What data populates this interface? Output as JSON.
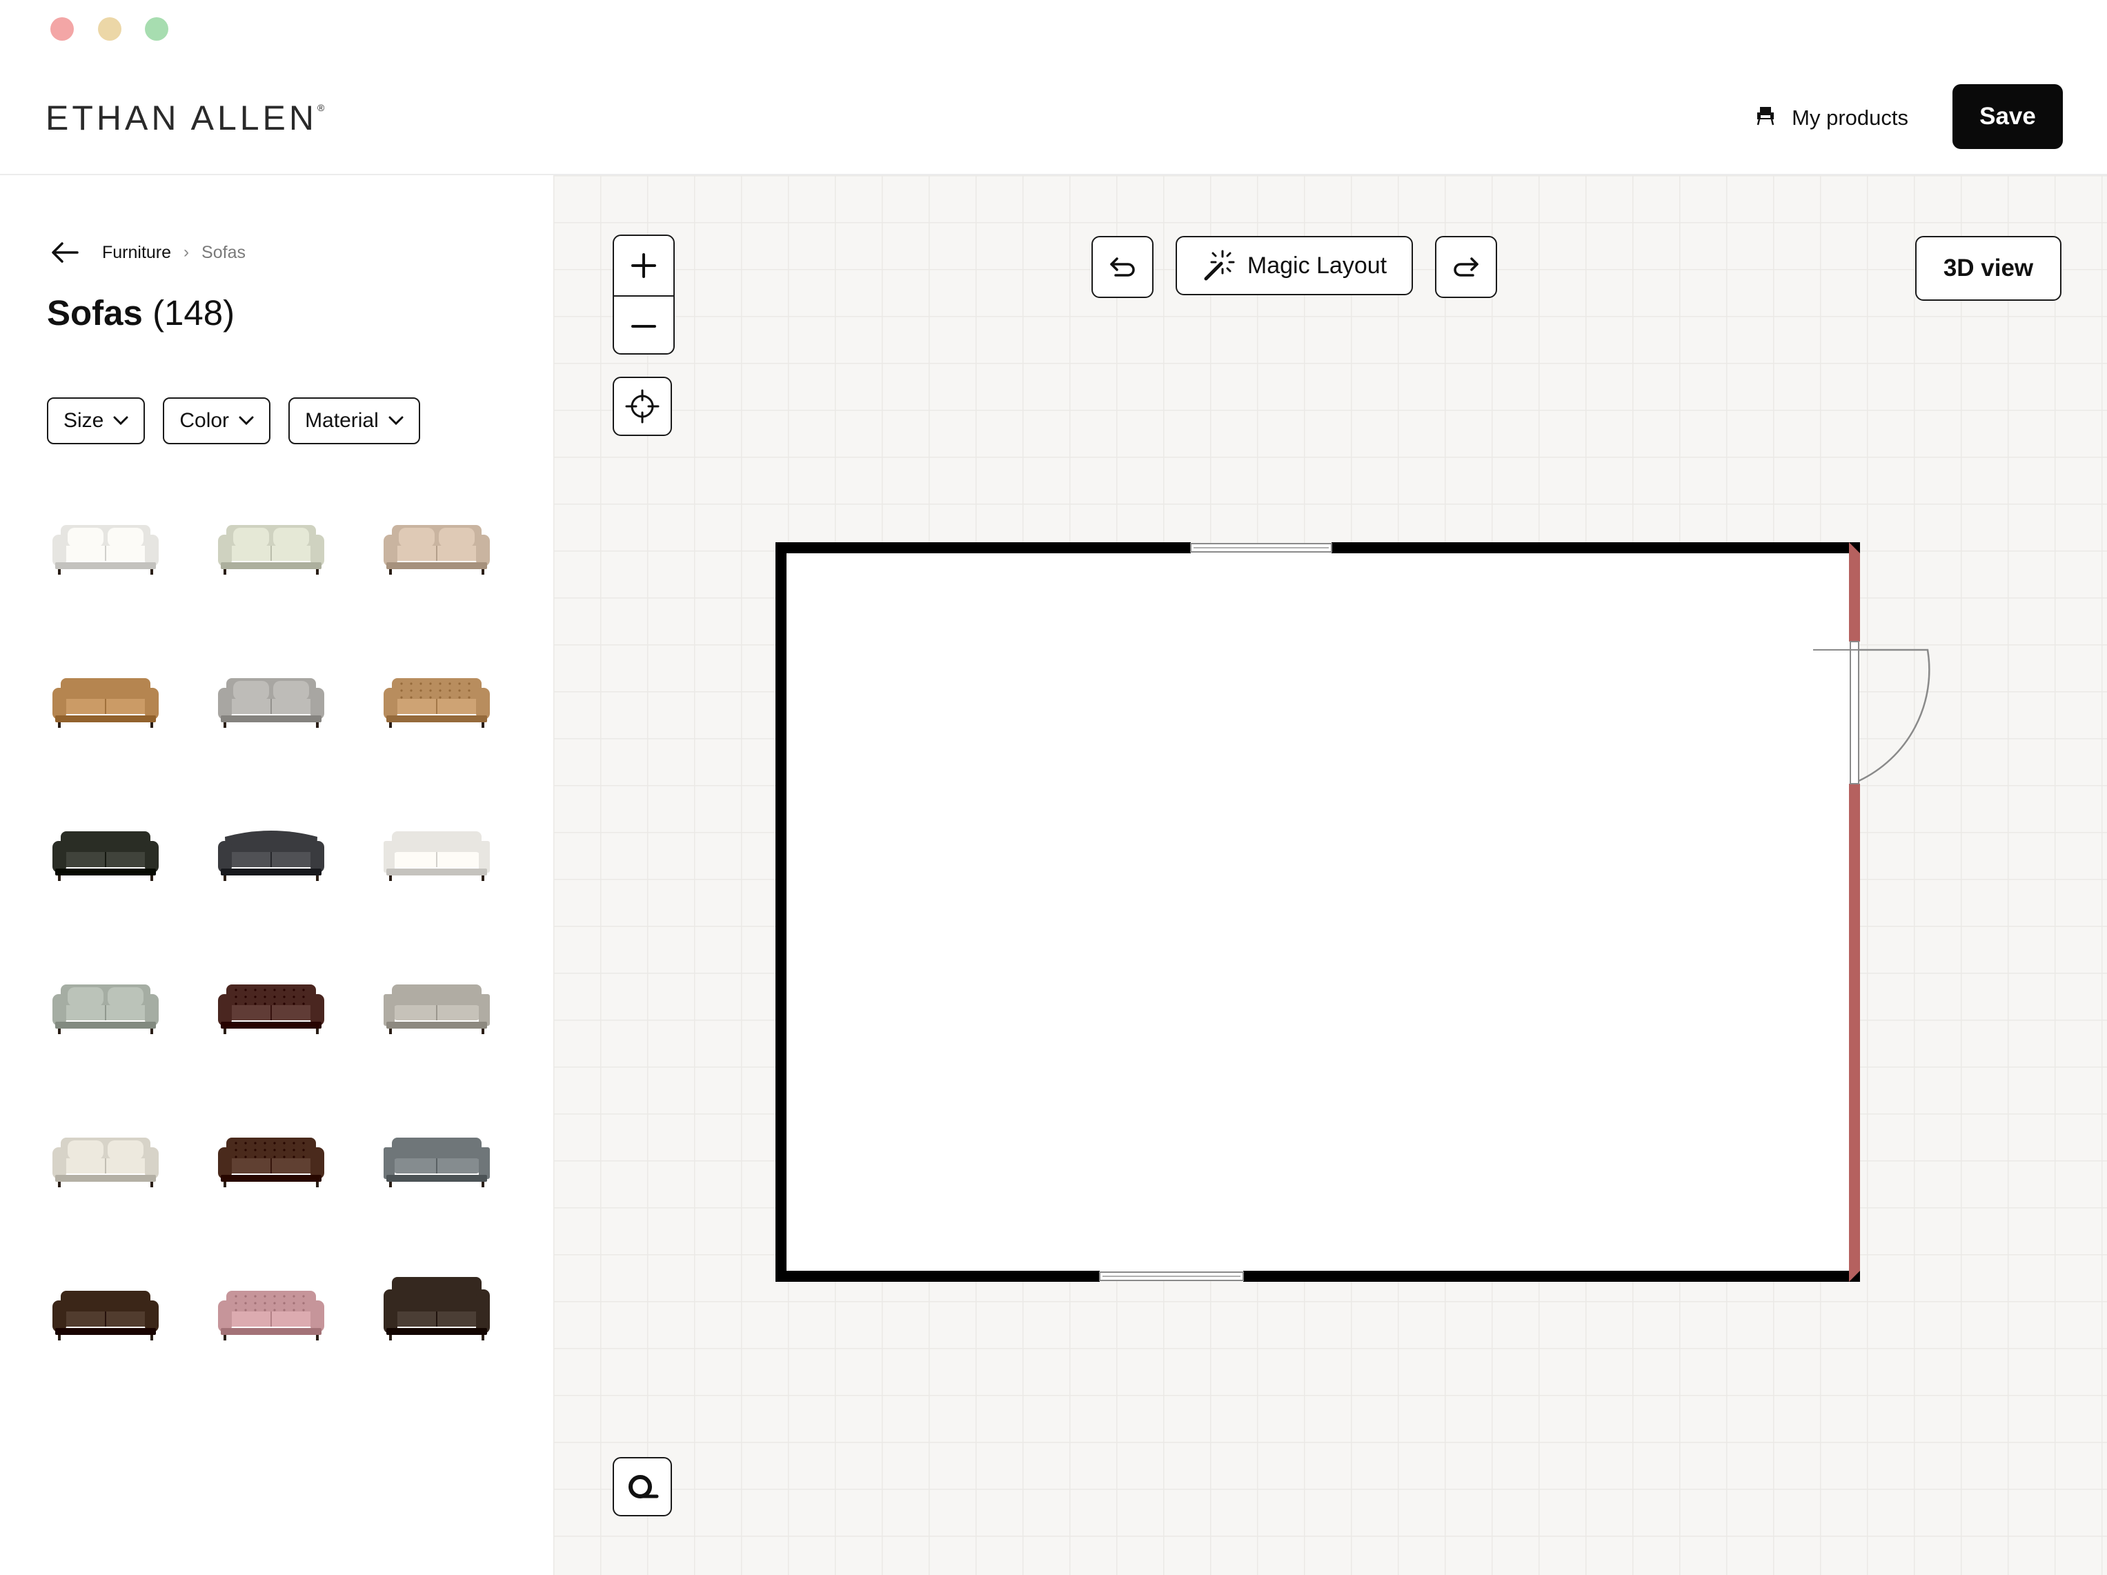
{
  "window": {
    "controls": [
      "close",
      "minimize",
      "maximize"
    ]
  },
  "header": {
    "logo": "ETHAN ALLEN",
    "logo_mark": "®",
    "my_products_label": "My products",
    "my_products_icon": "armchair-icon",
    "save_label": "Save"
  },
  "sidebar": {
    "breadcrumb": {
      "back_icon": "arrow-left-icon",
      "parent": "Furniture",
      "separator": "›",
      "current": "Sofas"
    },
    "title": "Sofas",
    "count": "(148)",
    "filters": [
      {
        "label": "Size"
      },
      {
        "label": "Color"
      },
      {
        "label": "Material"
      }
    ],
    "products": [
      {
        "color": "#e6e5e1",
        "style": "rolled-arm"
      },
      {
        "color": "#cfd2c0",
        "style": "cushion-back"
      },
      {
        "color": "#c9b4a0",
        "style": "rolled-arm"
      },
      {
        "color": "#b58550",
        "style": "leather-rolled"
      },
      {
        "color": "#a8a6a2",
        "style": "cushion-back"
      },
      {
        "color": "#b88d5e",
        "style": "chesterfield"
      },
      {
        "color": "#2a2d25",
        "style": "leather-rolled"
      },
      {
        "color": "#3a3b3f",
        "style": "curved"
      },
      {
        "color": "#e8e6e1",
        "style": "tuxedo"
      },
      {
        "color": "#a5ada3",
        "style": "rolled-arm"
      },
      {
        "color": "#4a2620",
        "style": "leather-tufted"
      },
      {
        "color": "#b0aca3",
        "style": "track-arm"
      },
      {
        "color": "#d7d3c8",
        "style": "cushion-back"
      },
      {
        "color": "#4a2a1c",
        "style": "leather-tufted"
      },
      {
        "color": "#6f7679",
        "style": "track-arm"
      },
      {
        "color": "#3b2618",
        "style": "leather-rolled"
      },
      {
        "color": "#c6959a",
        "style": "chesterfield"
      },
      {
        "color": "#35281f",
        "style": "tall-leather"
      }
    ]
  },
  "canvas": {
    "zoom_in_icon": "plus-icon",
    "zoom_out_icon": "minus-icon",
    "recenter_icon": "crosshair-icon",
    "undo_icon": "undo-icon",
    "redo_icon": "redo-icon",
    "magic_layout_label": "Magic Layout",
    "magic_layout_icon": "magic-wand-icon",
    "view_3d_label": "3D view",
    "measure_icon": "tape-measure-icon",
    "room": {
      "wall_color": "#000000",
      "highlight_wall_color": "#b5615f",
      "openings": [
        "top-window",
        "bottom-window",
        "right-door"
      ]
    }
  }
}
